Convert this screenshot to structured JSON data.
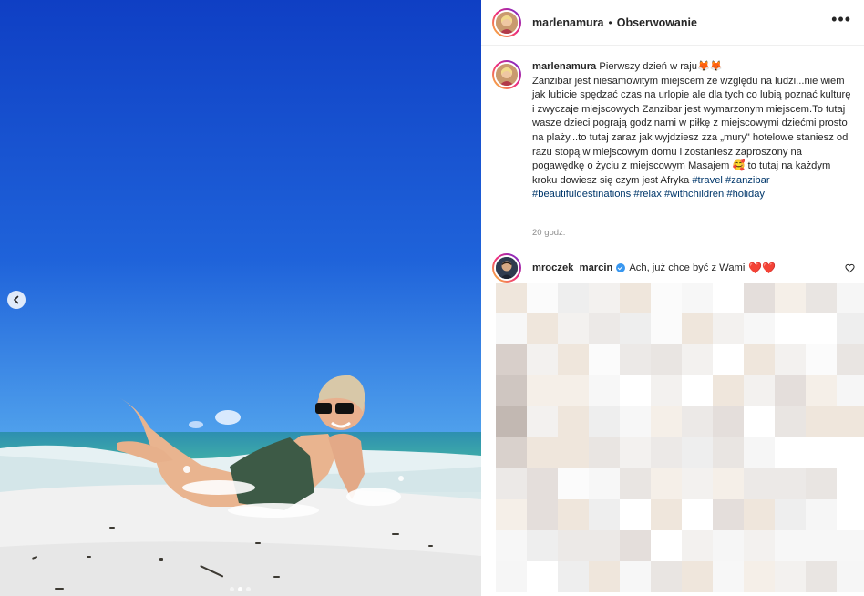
{
  "header": {
    "username": "marlenamura",
    "separator": "•",
    "follow_label": "Obserwowanie",
    "more_icon": "more-horizontal-icon"
  },
  "caption": {
    "username": "marlenamura",
    "line1": "Pierwszy dzień w raju🦊🦊",
    "body": "Zanzibar jest niesamowitym miejscem ze względu na ludzi...nie wiem jak lubicie spędzać czas na urlopie ale dla tych co lubią poznać kulturę i zwyczaje miejscowych Zanzibar jest wymarzonym miejscem.To tutaj wasze dzieci pograją godzinami w piłkę z miejscowymi dziećmi prosto na plaży...to tutaj zaraz jak wyjdziesz zza „mury\" hotelowe staniesz od razu stopą w miejscowym domu i zostaniesz zaproszony na pogawędkę o życiu z miejscowym Masajem 🥰 to tutaj na każdym kroku dowiesz się czym jest Afryka",
    "hashtags": [
      "#travel",
      "#zanzibar",
      "#beautifuldestinations",
      "#relax",
      "#withchildren",
      "#holiday"
    ],
    "time": "20 godz."
  },
  "comment": {
    "username": "mroczek_marcin",
    "text": "Ach, już chce być z Wami",
    "hearts": "❤️❤️"
  },
  "carousel": {
    "total": 3,
    "active": 1
  },
  "colors": {
    "sky_top": "#1546c8",
    "sky_bottom": "#3f8fe6",
    "sea": "#35a7a8",
    "sand": "#f2f2f2",
    "link": "#00376b",
    "verified": "#3897f0"
  }
}
